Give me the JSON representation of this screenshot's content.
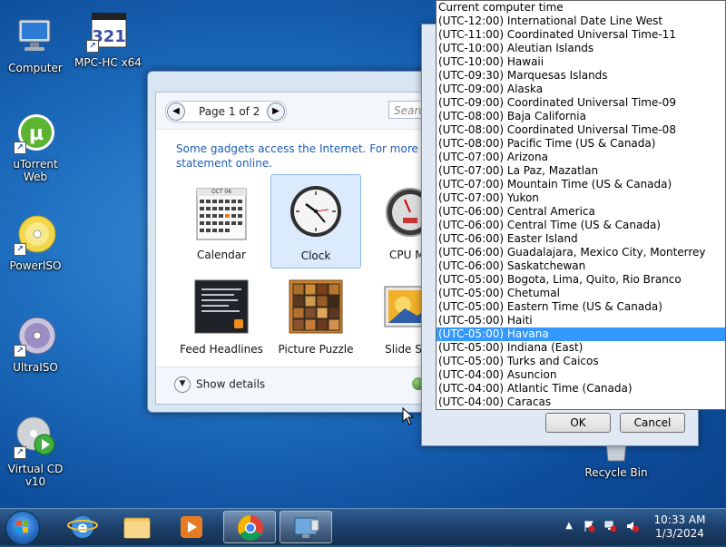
{
  "desktop": {
    "icons": [
      {
        "label": "Computer"
      },
      {
        "label": "MPC-HC x64"
      },
      {
        "label": "uTorrent Web"
      },
      {
        "label": "PowerISO"
      },
      {
        "label": "UltraISO"
      },
      {
        "label": "Virtual CD v10"
      },
      {
        "label": "Recycle Bin"
      }
    ]
  },
  "gallery": {
    "page_label": "Page 1 of 2",
    "search_placeholder": "Search",
    "notice_line1": "Some gadgets access the Internet.  For more inform",
    "notice_line2": "statement online.",
    "gadgets": [
      {
        "label": "Calendar"
      },
      {
        "label": "Clock"
      },
      {
        "label": "CPU Me"
      },
      {
        "label": "Feed Headlines"
      },
      {
        "label": "Picture Puzzle"
      },
      {
        "label": "Slide Sho"
      }
    ],
    "calendar_month": "OCT 06",
    "show_details": "Show details"
  },
  "timezone_dialog": {
    "ok_label": "OK",
    "cancel_label": "Cancel",
    "selected_index": 24,
    "items": [
      "Current computer time",
      "(UTC-12:00) International Date Line West",
      "(UTC-11:00) Coordinated Universal Time-11",
      "(UTC-10:00) Aleutian Islands",
      "(UTC-10:00) Hawaii",
      "(UTC-09:30) Marquesas Islands",
      "(UTC-09:00) Alaska",
      "(UTC-09:00) Coordinated Universal Time-09",
      "(UTC-08:00) Baja California",
      "(UTC-08:00) Coordinated Universal Time-08",
      "(UTC-08:00) Pacific Time (US & Canada)",
      "(UTC-07:00) Arizona",
      "(UTC-07:00) La Paz, Mazatlan",
      "(UTC-07:00) Mountain Time (US & Canada)",
      "(UTC-07:00) Yukon",
      "(UTC-06:00) Central America",
      "(UTC-06:00) Central Time (US & Canada)",
      "(UTC-06:00) Easter Island",
      "(UTC-06:00) Guadalajara, Mexico City, Monterrey",
      "(UTC-06:00) Saskatchewan",
      "(UTC-05:00) Bogota, Lima, Quito, Rio Branco",
      "(UTC-05:00) Chetumal",
      "(UTC-05:00) Eastern Time (US & Canada)",
      "(UTC-05:00) Haiti",
      "(UTC-05:00) Havana",
      "(UTC-05:00) Indiana (East)",
      "(UTC-05:00) Turks and Caicos",
      "(UTC-04:00) Asuncion",
      "(UTC-04:00) Atlantic Time (Canada)",
      "(UTC-04:00) Caracas"
    ]
  },
  "taskbar": {
    "time": "10:33 AM",
    "date": "1/3/2024",
    "pinned": [
      "Internet Explorer",
      "Windows Explorer",
      "Windows Media Player",
      "Google Chrome",
      "Gadgets"
    ]
  },
  "colors": {
    "selection": "#3399ff",
    "link": "#1e5fb5",
    "taskbar": "#1d3f6b"
  }
}
